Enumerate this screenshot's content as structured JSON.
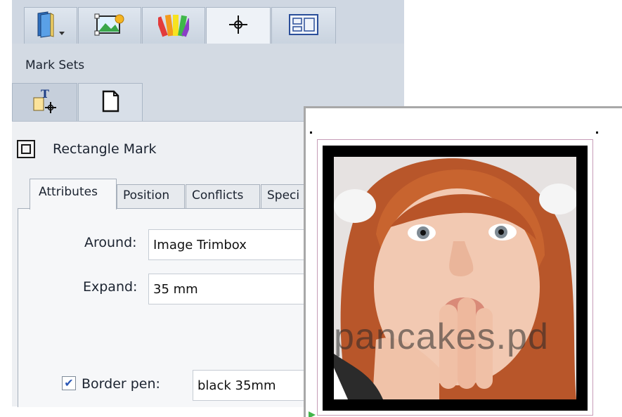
{
  "colors": {
    "tab_bar": "#cfd7e2",
    "panel_bg": "#eef0f3",
    "checkbox_check": "#2b57b5",
    "page_outline": "#c79db8"
  },
  "top_tabs": [
    {
      "icon": "book-dropdown-icon",
      "active": false
    },
    {
      "icon": "image-frame-icon",
      "active": false
    },
    {
      "icon": "color-swatches-icon",
      "active": false
    },
    {
      "icon": "crosshair-marks-icon",
      "active": true
    },
    {
      "icon": "layout-template-icon",
      "active": false
    }
  ],
  "mark_sets": {
    "label": "Mark Sets",
    "tabs": [
      {
        "icon": "text-mark-add-icon",
        "active": false
      },
      {
        "icon": "page-mark-icon",
        "active": true
      }
    ]
  },
  "mark": {
    "icon": "rectangle-mark-icon",
    "title": "Rectangle Mark"
  },
  "inner_tabs": [
    "Attributes",
    "Position",
    "Conflicts",
    "Speci"
  ],
  "form": {
    "around_label": "Around:",
    "around_value": "Image Trimbox",
    "expand_label": "Expand:",
    "expand_value": "35 mm",
    "border_pen_label": "Border pen:",
    "border_pen_checked": true,
    "border_pen_value": "black 35mm"
  },
  "preview": {
    "watermark": "pancakes.pd"
  }
}
